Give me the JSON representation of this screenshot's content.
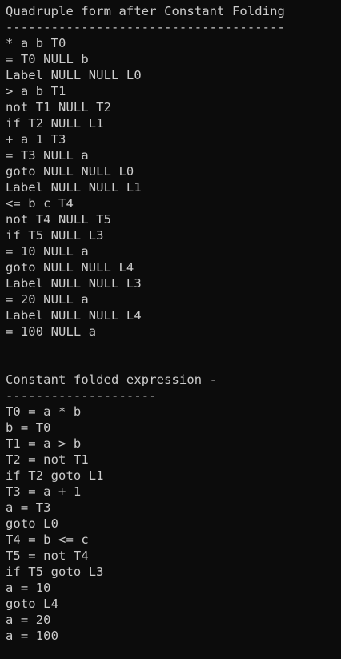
{
  "terminal": {
    "background": "#0c0c0c",
    "foreground": "#cccccc",
    "lines": [
      "Quadruple form after Constant Folding",
      "-------------------------------------",
      "* a b T0",
      "= T0 NULL b",
      "Label NULL NULL L0",
      "> a b T1",
      "not T1 NULL T2",
      "if T2 NULL L1",
      "+ a 1 T3",
      "= T3 NULL a",
      "goto NULL NULL L0",
      "Label NULL NULL L1",
      "<= b c T4",
      "not T4 NULL T5",
      "if T5 NULL L3",
      "= 10 NULL a",
      "goto NULL NULL L4",
      "Label NULL NULL L3",
      "= 20 NULL a",
      "Label NULL NULL L4",
      "= 100 NULL a",
      "",
      "",
      "Constant folded expression -",
      "--------------------",
      "T0 = a * b",
      "b = T0",
      "T1 = a > b",
      "T2 = not T1",
      "if T2 goto L1",
      "T3 = a + 1",
      "a = T3",
      "goto L0",
      "T4 = b <= c",
      "T5 = not T4",
      "if T5 goto L3",
      "a = 10",
      "goto L4",
      "a = 20",
      "a = 100"
    ]
  }
}
